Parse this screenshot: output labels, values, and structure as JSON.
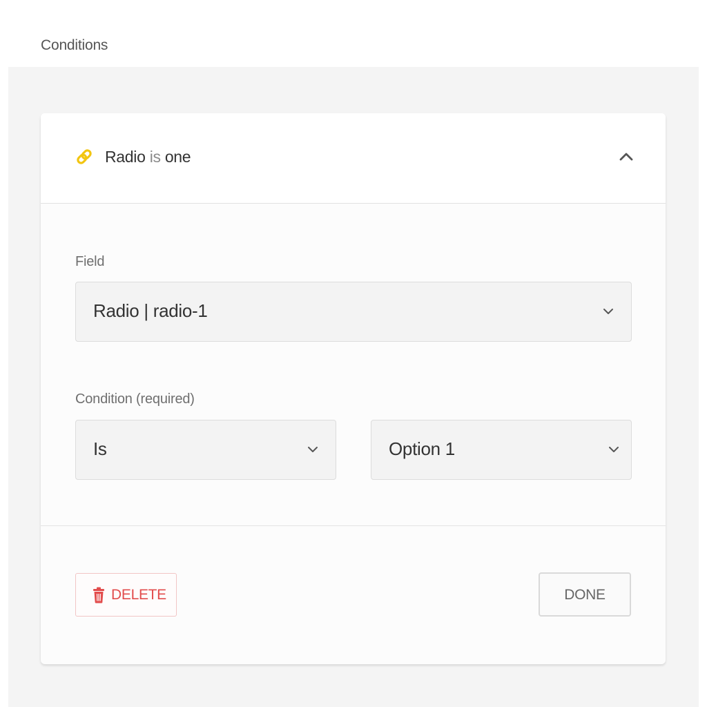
{
  "section_title": "Conditions",
  "condition": {
    "header": {
      "field_name": "Radio",
      "operator": "is",
      "value": "one",
      "icon": "link-icon",
      "toggle_icon": "chevron-up-icon"
    },
    "field": {
      "label": "Field",
      "selected": "Radio | radio-1"
    },
    "rule": {
      "label": "Condition (required)",
      "operator_selected": "Is",
      "value_selected": "Option 1"
    },
    "actions": {
      "delete_label": "DELETE",
      "done_label": "DONE"
    }
  },
  "colors": {
    "icon_accent": "#f2c511",
    "delete_red": "#e24c4c"
  }
}
